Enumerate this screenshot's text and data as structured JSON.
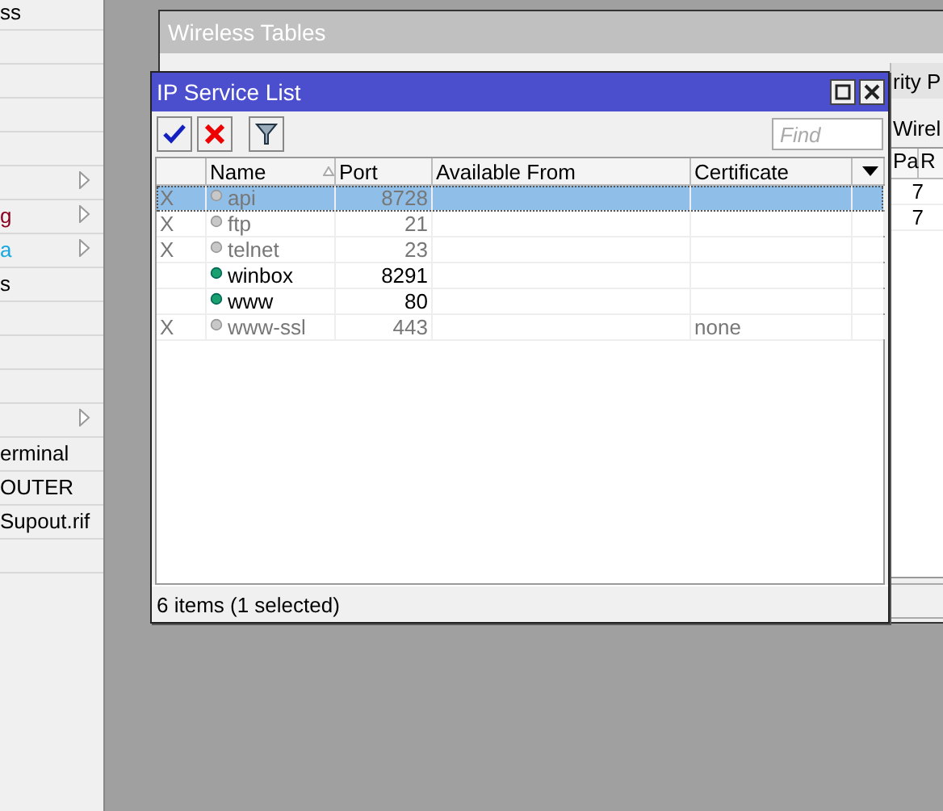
{
  "sidebar": {
    "items": [
      {
        "label": "ss",
        "color": "#000000",
        "has_submenu": false
      },
      {
        "has_submenu": false
      },
      {
        "has_submenu": false
      },
      {
        "has_submenu": false
      },
      {
        "has_submenu": false
      },
      {
        "has_submenu": true
      },
      {
        "label": "g",
        "color": "#8b0020",
        "has_submenu": true
      },
      {
        "label": "a",
        "color": "#16a8e0",
        "has_submenu": true
      },
      {
        "label": "s",
        "color": "#000000",
        "has_submenu": false
      },
      {
        "has_submenu": false
      },
      {
        "has_submenu": false
      },
      {
        "has_submenu": false
      },
      {
        "has_submenu": true
      },
      {
        "label": "erminal",
        "color": "#000000",
        "has_submenu": false
      },
      {
        "label": "OUTER",
        "color": "#000000",
        "has_submenu": false
      },
      {
        "label": "Supout.rif",
        "color": "#000000",
        "has_submenu": false
      },
      {
        "has_submenu": false
      }
    ]
  },
  "background_window": {
    "title": "Wireless Tables",
    "tab": "rity P",
    "subtab": "Wirel",
    "columns": [
      "Pa",
      "R"
    ],
    "rows": [
      [
        "7"
      ],
      [
        "7"
      ]
    ]
  },
  "dialog": {
    "title": "IP Service List",
    "search": {
      "placeholder": "Find"
    },
    "columns": [
      "Name",
      "Port",
      "Available From",
      "Certificate"
    ],
    "rows": [
      {
        "flag": "X",
        "disabled": true,
        "name": "api",
        "port": "8728",
        "selected": true
      },
      {
        "flag": "X",
        "disabled": true,
        "name": "ftp",
        "port": "21",
        "selected": false
      },
      {
        "flag": "X",
        "disabled": true,
        "name": "telnet",
        "port": "23",
        "selected": false
      },
      {
        "disabled": false,
        "name": "winbox",
        "port": "8291",
        "selected": false
      },
      {
        "disabled": false,
        "name": "www",
        "port": "80",
        "selected": false
      },
      {
        "flag": "X",
        "disabled": true,
        "name": "www-ssl",
        "port": "443",
        "certificate": "none",
        "selected": false
      }
    ],
    "status": "6 items (1 selected)"
  }
}
